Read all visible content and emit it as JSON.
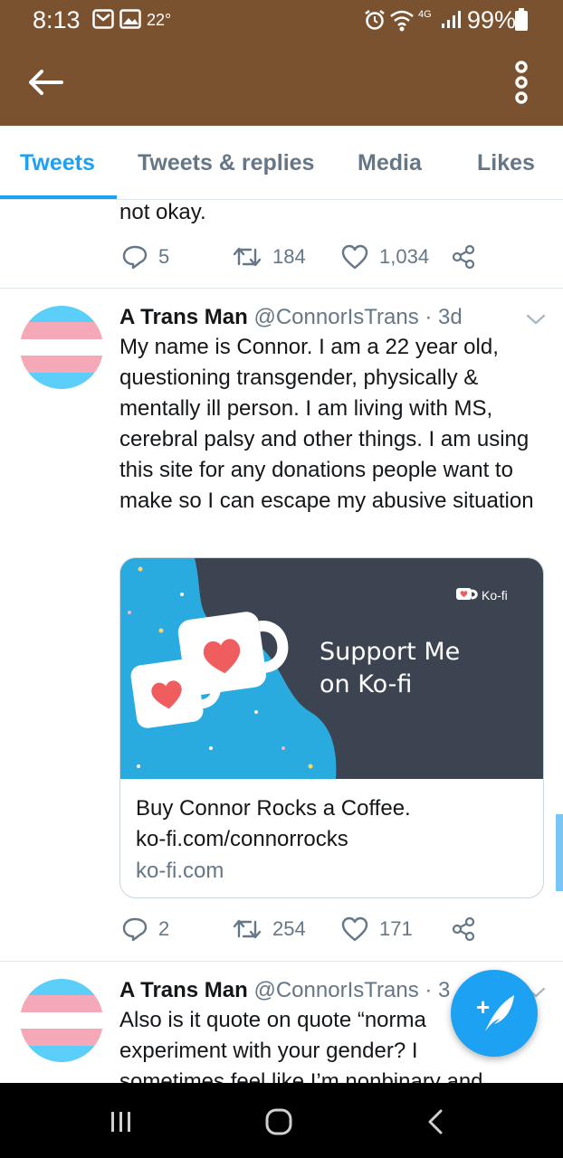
{
  "status_bar": {
    "time": "8:13",
    "temperature": "22°",
    "network": "4G",
    "battery": "99%"
  },
  "app_bar": {
    "back_icon": "arrow-left-icon",
    "more_icon": "more-vertical-icon",
    "background_color": "#7a5230"
  },
  "tabs": [
    {
      "label": "Tweets",
      "active": true
    },
    {
      "label": "Tweets & replies",
      "active": false
    },
    {
      "label": "Media",
      "active": false
    },
    {
      "label": "Likes",
      "active": false
    }
  ],
  "accent_color": "#1da1f2",
  "tweets": [
    {
      "text": "not okay.",
      "replies": "5",
      "retweets": "184",
      "likes": "1,034"
    },
    {
      "name": "A Trans Man",
      "handle": "@ConnorIsTrans",
      "time": "· 3d",
      "text": "My name is Connor. I am a 22 year old, questioning transgender, physically & mentally ill person. I am living with MS, cerebral palsy and other things. I am using this site for any donations people want to make so I can escape my abusive situation",
      "card": {
        "image_brand": "Ko-fi",
        "image_headline_1": "Support Me",
        "image_headline_2": "on Ko-fi",
        "title": "Buy Connor Rocks a Coffee.",
        "description": "ko-fi.com/connorrocks",
        "domain": "ko-fi.com"
      },
      "replies": "2",
      "retweets": "254",
      "likes": "171"
    },
    {
      "name": "A Trans Man",
      "handle": "@ConnorIsTrans",
      "time": "· 3",
      "text_lines": [
        "Also is it quote on quote “norma",
        "experiment with your gender? I",
        "sometimes feel like I’m nonbinary and"
      ]
    }
  ],
  "fab": {
    "icon": "compose-tweet-icon",
    "symbol": "+"
  },
  "nav_bar": {
    "icons": [
      "recents-icon",
      "home-icon",
      "back-icon"
    ]
  }
}
